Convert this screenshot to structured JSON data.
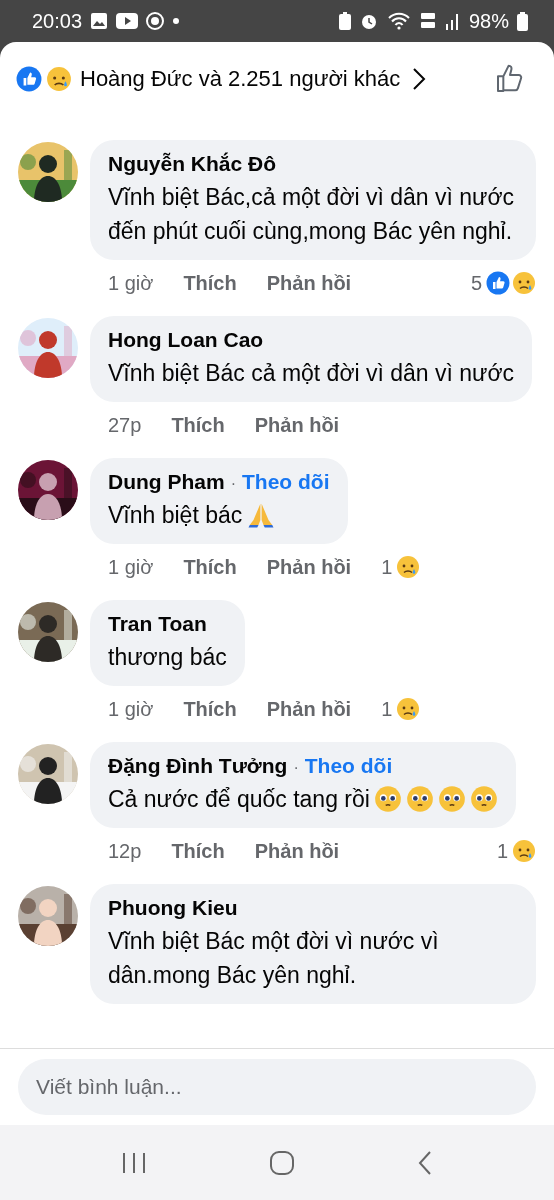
{
  "status_bar": {
    "time": "20:03",
    "battery": "98%"
  },
  "reactions_header": {
    "types": [
      {
        "kind": "like"
      },
      {
        "kind": "sad"
      }
    ],
    "text": "Hoàng Đức và 2.251 người khác"
  },
  "comments": [
    {
      "author": "Nguyễn Khắc Đô",
      "text": "Vĩnh biệt Bác,cả một đời vì dân vì nước đến phút cuối cùng,mong Bác yên nghỉ.",
      "time": "1 giờ",
      "like": "Thích",
      "reply": "Phản hồi",
      "reactions": {
        "count": "5",
        "types": [
          {
            "kind": "like"
          },
          {
            "kind": "sad"
          }
        ]
      }
    },
    {
      "author": "Hong Loan Cao",
      "text": "Vĩnh biệt Bác cả một đời vì dân vì nước",
      "time": "27p",
      "like": "Thích",
      "reply": "Phản hồi"
    },
    {
      "author": "Dung Pham",
      "separator": "·",
      "follow": "Theo dõi",
      "text": "Vĩnh biệt bác",
      "emoji": [
        {
          "kind": "folded-hands"
        }
      ],
      "time": "1 giờ",
      "like": "Thích",
      "reply": "Phản hồi",
      "reactions": {
        "count": "1",
        "types": [
          {
            "kind": "sad"
          }
        ]
      }
    },
    {
      "author": "Tran Toan",
      "text": "thương bác",
      "time": "1 giờ",
      "like": "Thích",
      "reply": "Phản hồi",
      "reactions": {
        "count": "1",
        "types": [
          {
            "kind": "sad"
          }
        ]
      }
    },
    {
      "author": "Đặng Đình Tưởng",
      "separator": "·",
      "follow": "Theo dõi",
      "text": "Cả nước để quốc tang rồi",
      "emoji": [
        {
          "kind": "pleading"
        },
        {
          "kind": "pleading"
        },
        {
          "kind": "pleading"
        },
        {
          "kind": "pleading"
        }
      ],
      "time": "12p",
      "like": "Thích",
      "reply": "Phản hồi",
      "reactions": {
        "count": "1",
        "types": [
          {
            "kind": "sad"
          }
        ]
      }
    },
    {
      "author": "Phuong Kieu",
      "text": "Vĩnh biệt Bác một đời vì nước vì dân.mong Bác yên nghỉ."
    }
  ],
  "composer": {
    "placeholder": "Viết bình luận..."
  }
}
